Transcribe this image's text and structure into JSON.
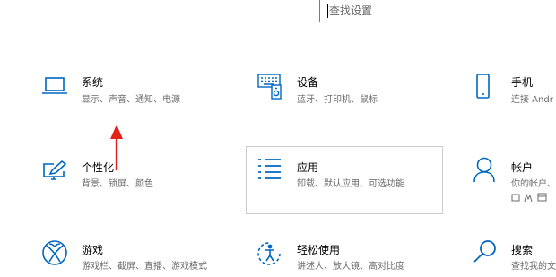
{
  "search": {
    "placeholder": "查找设置",
    "value": ""
  },
  "tiles": [
    {
      "title": "系统",
      "desc": "显示、声音、通知、电源",
      "icon": "laptop-icon"
    },
    {
      "title": "设备",
      "desc": "蓝牙、打印机、鼠标",
      "icon": "devices-icon"
    },
    {
      "title": "手机",
      "desc": "连接 Andr",
      "icon": "phone-icon"
    },
    {
      "title": "个性化",
      "desc": "背景、锁屏、颜色",
      "icon": "personalization-icon"
    },
    {
      "title": "应用",
      "desc": "卸载、默认应用、可选功能",
      "icon": "apps-list-icon"
    },
    {
      "title": "帐户",
      "desc": "你的帐户、",
      "icon": "account-icon"
    },
    {
      "title": "游戏",
      "desc": "游戏栏、截屏、直播、游戏模式",
      "icon": "xbox-icon"
    },
    {
      "title": "轻松使用",
      "desc": "讲述人、放大镜、高对比度",
      "icon": "ease-of-access-icon"
    },
    {
      "title": "搜索",
      "desc": "查找我的文",
      "icon": "search-icon"
    }
  ],
  "colors": {
    "accent": "#0067c0",
    "arrow": "#e3211b",
    "border": "#cccccc"
  }
}
